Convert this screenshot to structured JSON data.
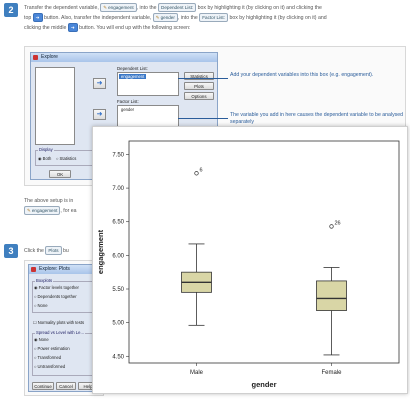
{
  "step2": {
    "number": "2",
    "line1": "Transfer the dependent variable,",
    "var_dep": "engagement",
    "line1b": ", into the",
    "dep_box": "Dependent List:",
    "line1c": "box by highlighting it (by clicking on it) and clicking the",
    "line2a": "top",
    "line2b": "button. Also, transfer the independent variable,",
    "var_ind": "gender",
    "line2c": ", into the",
    "factor_box": "Factor List:",
    "line2d": "box by highlighting it (by clicking on it) and",
    "line3a": "clicking the middle",
    "line3b": "button. You will end up with the following screen:"
  },
  "explore_dialog": {
    "title": "Explore",
    "dependent_list_label": "Dependent List:",
    "dependent_item": "engagement",
    "factor_list_label": "Factor List:",
    "factor_item": "gender",
    "buttons": [
      "Statistics",
      "Plots",
      "Options"
    ],
    "display_label": "Display",
    "display_options": [
      "Both",
      "Statistics",
      "Plots"
    ],
    "ok": "OK"
  },
  "callouts": {
    "dependent": "Add your dependent variables into this box (e.g. engagement).",
    "factor": "The variable you add in here causes the dependent variable to be analysed separately"
  },
  "middle_text": {
    "line1a": "The above setup is in",
    "line2a": "engagement",
    "line2b": ", for ea"
  },
  "step3": {
    "number": "3",
    "text_a": "Click the",
    "plots_btn": "Plots",
    "text_b": "bu"
  },
  "plots_dialog": {
    "title": "Explore: Plots",
    "boxplots_label": "Boxplots",
    "boxplot_options": [
      "Factor levels together",
      "Dependents together",
      "None"
    ],
    "normality": "Normality plots with tests",
    "spread_label": "Spread vs Level with Le...",
    "spread_options": [
      "None",
      "Power estimation",
      "Transformed",
      "Untransformed"
    ],
    "power_label": "Power:",
    "buttons": [
      "Continue",
      "Cancel",
      "Help"
    ]
  },
  "chart_data": {
    "type": "boxplot",
    "xlabel": "gender",
    "ylabel": "engagement",
    "categories": [
      "Male",
      "Female"
    ],
    "yticks": [
      "4.50",
      "5.00",
      "5.50",
      "6.00",
      "6.50",
      "7.00",
      "7.50"
    ],
    "ylim": [
      4.4,
      7.7
    ],
    "boxes": [
      {
        "name": "Male",
        "min": 4.96,
        "q1": 5.45,
        "median": 5.6,
        "q3": 5.75,
        "max": 6.17
      },
      {
        "name": "Female",
        "min": 4.52,
        "q1": 5.18,
        "median": 5.36,
        "q3": 5.62,
        "max": 5.82
      }
    ],
    "outliers": [
      {
        "category": "Male",
        "y": 7.22,
        "label": "6"
      },
      {
        "category": "Female",
        "y": 6.43,
        "label": "26"
      }
    ],
    "colors": {
      "box_fill": "#d9d6a6",
      "box_stroke": "#333333"
    }
  }
}
